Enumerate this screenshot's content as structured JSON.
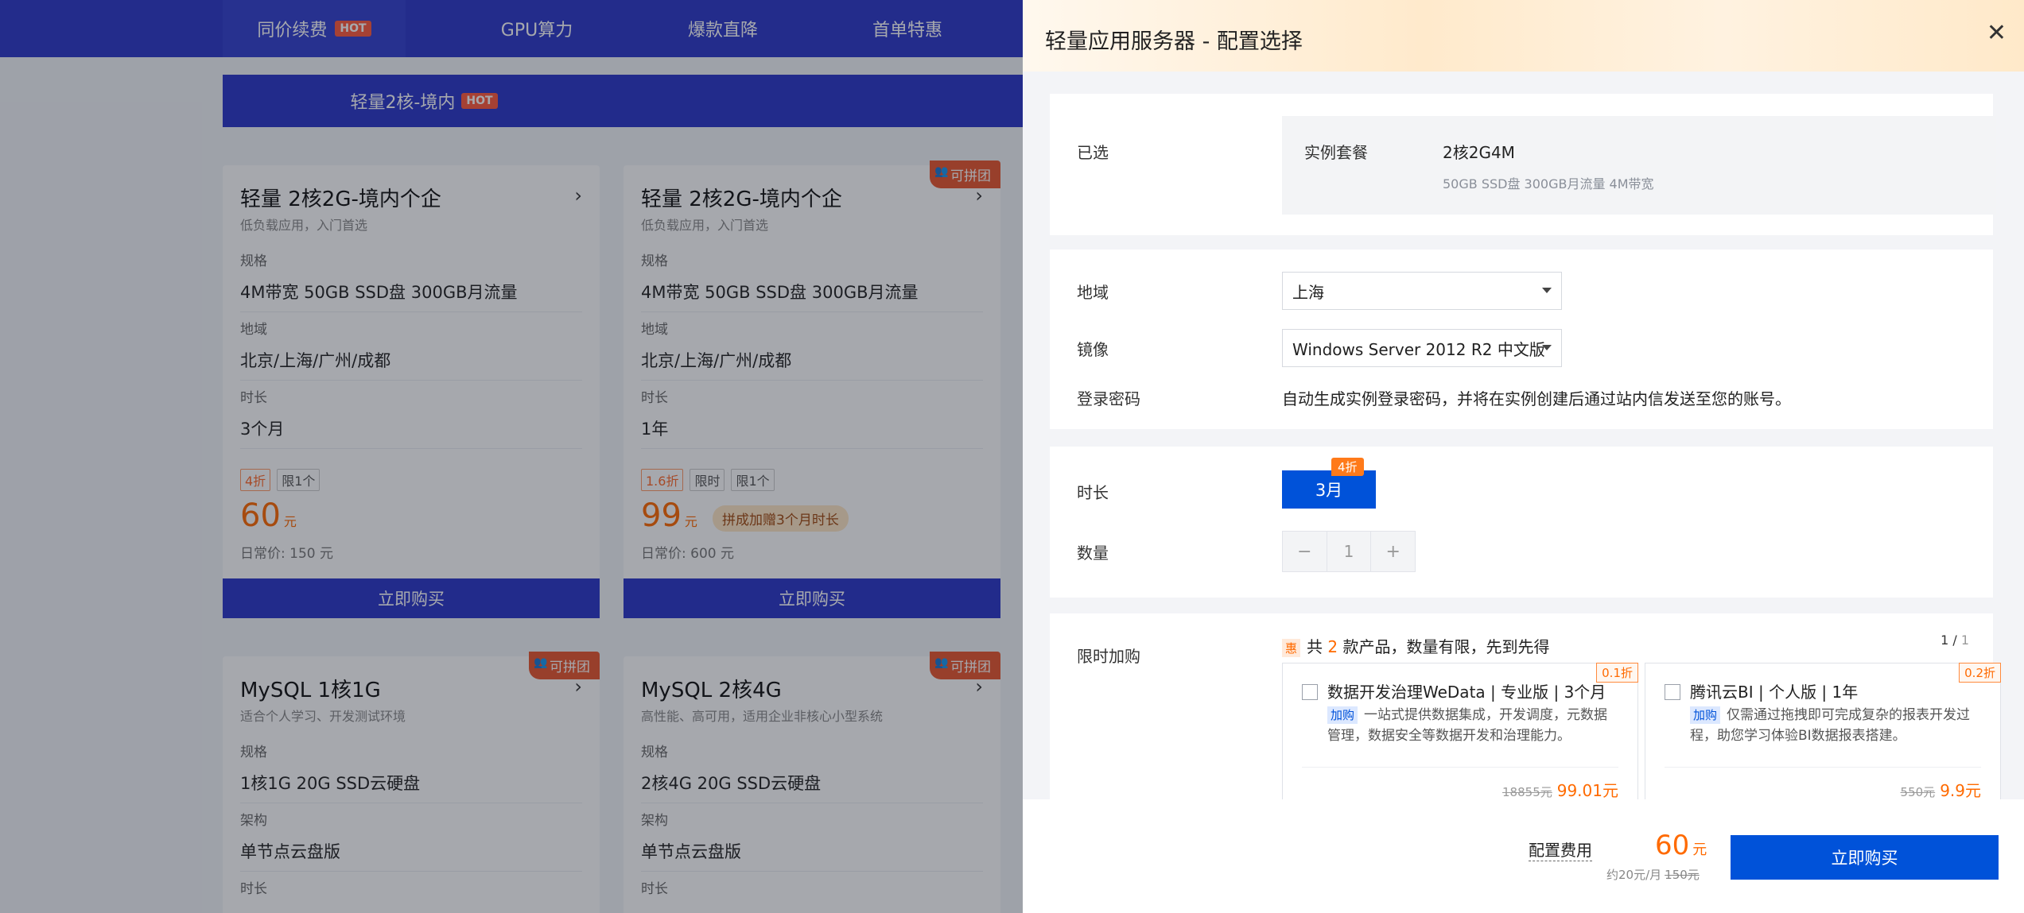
{
  "top_nav": {
    "tabs": [
      {
        "label": "同价续费",
        "badge": "HOT"
      },
      {
        "label": "GPU算力"
      },
      {
        "label": "爆款直降"
      },
      {
        "label": "首单特惠"
      }
    ]
  },
  "sub_tab": {
    "label": "轻量2核-境内",
    "badge": "HOT"
  },
  "cards": [
    {
      "title": "轻量 2核2G-境内个企",
      "subtitle": "低负载应用，入门首选",
      "f1_label": "规格",
      "f1_value": "4M带宽 50GB SSD盘 300GB月流量",
      "f2_label": "地域",
      "f2_value": "北京/上海/广州/成都",
      "f3_label": "时长",
      "f3_value": "3个月",
      "tag_discount": "4折",
      "tag_limit": "限1个",
      "price": "60",
      "price_unit": "元",
      "orig_price": "日常价: 150 元",
      "buy": "立即购买"
    },
    {
      "title": "轻量 2核2G-境内个企",
      "subtitle": "低负载应用，入门首选",
      "badge": "可拼团",
      "f1_label": "规格",
      "f1_value": "4M带宽 50GB SSD盘 300GB月流量",
      "f2_label": "地域",
      "f2_value": "北京/上海/广州/成都",
      "f3_label": "时长",
      "f3_value": "1年",
      "tag_discount": "1.6折",
      "tag_time": "限时",
      "tag_limit": "限1个",
      "price": "99",
      "price_unit": "元",
      "promo": "拼成加赠3个月时长",
      "orig_price": "日常价: 600 元",
      "buy": "立即购买"
    },
    {
      "title": "MySQL 1核1G",
      "subtitle": "适合个人学习、开发测试环境",
      "badge": "可拼团",
      "f1_label": "规格",
      "f1_value": "1核1G 20G SSD云硬盘",
      "f2_label": "架构",
      "f2_value": "单节点云盘版",
      "f3_label": "时长"
    },
    {
      "title": "MySQL 2核4G",
      "subtitle": "高性能、高可用，适用企业非核心小型系统",
      "badge": "可拼团",
      "f1_label": "规格",
      "f1_value": "2核4G 20G SSD云硬盘",
      "f2_label": "架构",
      "f2_value": "单节点云盘版",
      "f3_label": "时长"
    }
  ],
  "drawer": {
    "title": "轻量应用服务器 - 配置选择",
    "selected": {
      "label": "已选",
      "key": "实例套餐",
      "value": "2核2G4M",
      "detail": "50GB SSD盘 300GB月流量 4M带宽"
    },
    "region": {
      "label": "地域",
      "value": "上海"
    },
    "image": {
      "label": "镜像",
      "value": "Windows Server 2012 R2 中文版"
    },
    "password": {
      "label": "登录密码",
      "text": "自动生成实例登录密码，并将在实例创建后通过站内信发送至您的账号。"
    },
    "duration": {
      "label": "时长",
      "option": "3月",
      "tag": "4折"
    },
    "quantity": {
      "label": "数量",
      "minus": "−",
      "value": "1",
      "plus": "+"
    },
    "addon": {
      "label": "限时加购",
      "hui": "惠",
      "prefix": "共",
      "count": "2",
      "suffix": "款产品，数量有限，先到先得",
      "page_current": "1",
      "page_sep": " / ",
      "page_total": "1",
      "items": [
        {
          "title": "数据开发治理WeData | 专业版 | 3个月",
          "tag": "加购",
          "desc": "一站式提供数据集成，开发调度，元数据管理，数据安全等数据开发和治理能力。",
          "orig": "18855元",
          "price": "99.01元",
          "discount": "0.1折"
        },
        {
          "title": "腾讯云BI | 个人版 | 1年",
          "tag": "加购",
          "desc": "仅需通过拖拽即可完成复杂的报表开发过程，助您学习体验BI数据报表搭建。",
          "orig": "550元",
          "price": "9.9元",
          "discount": "0.2折"
        }
      ]
    },
    "footer": {
      "fee_label": "配置费用",
      "price": "60",
      "unit": "元",
      "monthly": "约20元/月",
      "orig": "150元",
      "buy": "立即购买"
    }
  },
  "colors": {
    "brand_blue": "#0052d9",
    "nav_blue": "#2d38c8",
    "accent_orange": "#ff6a00"
  }
}
